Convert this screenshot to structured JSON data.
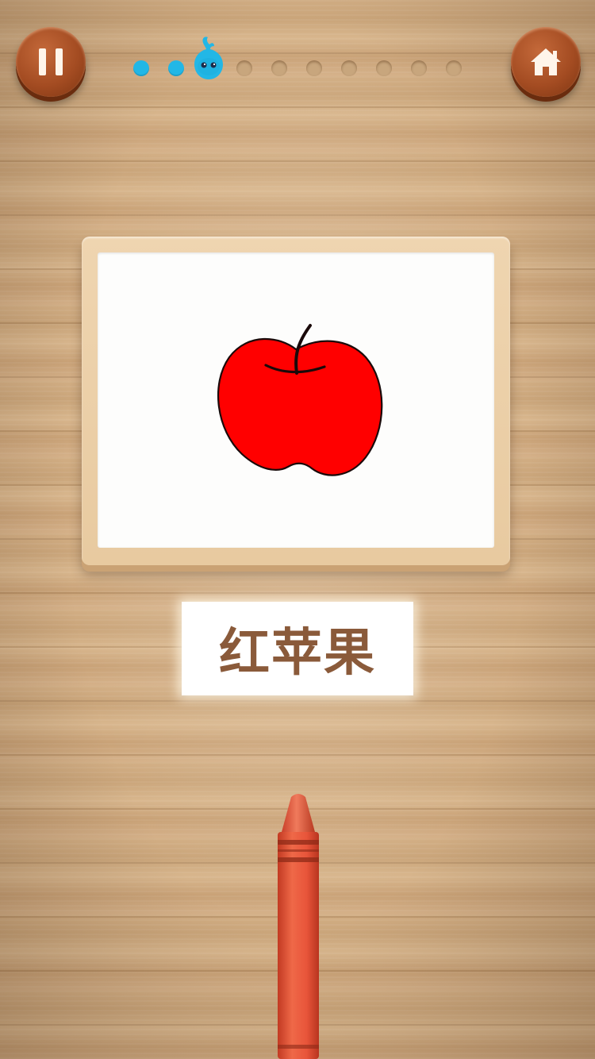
{
  "header": {
    "pause_icon": "pause-icon",
    "home_icon": "home-icon",
    "progress": {
      "total_steps": 10,
      "completed_steps": 2,
      "current_step": 3,
      "current_marker": "water-drop-mascot-icon",
      "done_color": "#22b7e6",
      "todo_color": "#c8a67d"
    }
  },
  "card": {
    "image": "red-apple-drawing",
    "apple_color": "#ff0000",
    "word": "红苹果"
  },
  "tool": {
    "icon": "crayon-icon",
    "color": "#e8553a"
  }
}
